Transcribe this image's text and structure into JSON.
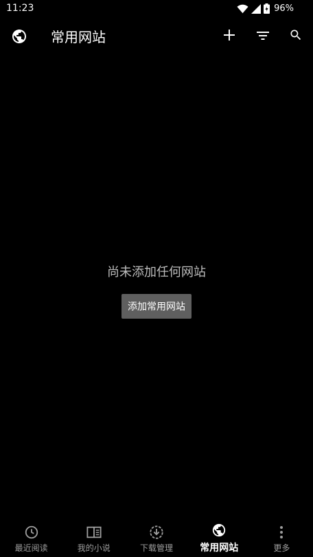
{
  "status_bar": {
    "time": "11:23",
    "battery": "96%",
    "icons": [
      "wifi-icon",
      "signal-icon",
      "battery-icon"
    ]
  },
  "toolbar": {
    "title": "常用网站",
    "leading_icon": "globe-icon",
    "actions": [
      "add-icon",
      "filter-icon",
      "search-icon"
    ]
  },
  "empty_state": {
    "message": "尚未添加任何网站",
    "button_label": "添加常用网站"
  },
  "bottom_nav": {
    "items": [
      {
        "label": "最近阅读",
        "icon": "clock-icon",
        "active": false
      },
      {
        "label": "我的小说",
        "icon": "book-icon",
        "active": false
      },
      {
        "label": "下载管理",
        "icon": "download-icon",
        "active": false
      },
      {
        "label": "常用网站",
        "icon": "globe-icon",
        "active": true
      },
      {
        "label": "更多",
        "icon": "more-vert-icon",
        "active": false
      }
    ]
  },
  "colors": {
    "background": "#000000",
    "text_primary": "#ffffff",
    "text_secondary": "#9e9e9e",
    "empty_text": "#bdbdbd",
    "button_bg": "#5f5f5f"
  }
}
